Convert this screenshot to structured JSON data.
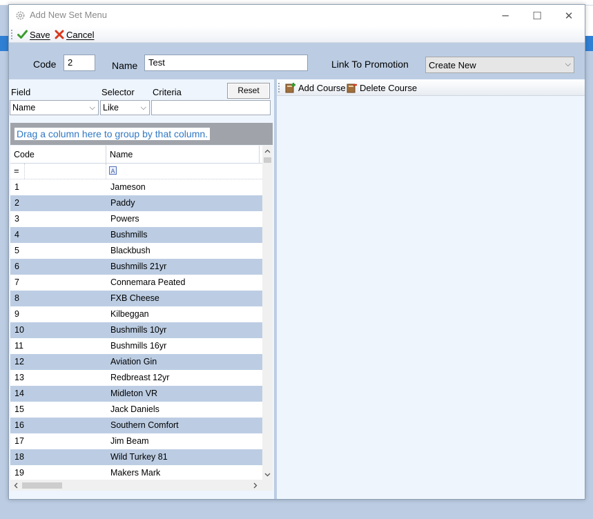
{
  "window": {
    "title": "Add New Set Menu",
    "min_glyph": "─",
    "max_glyph": "☐",
    "close_glyph": "✕"
  },
  "toolbar": {
    "save_label": "Save",
    "cancel_label": "Cancel"
  },
  "form": {
    "code_label": "Code",
    "code_value": "2",
    "name_label": "Name",
    "name_value": "Test",
    "promotion_label": "Link To Promotion",
    "promotion_value": "Create New"
  },
  "filter": {
    "field_label": "Field",
    "selector_label": "Selector",
    "criteria_label": "Criteria",
    "field_value": "Name",
    "selector_value": "Like",
    "criteria_value": "",
    "reset_label": "Reset"
  },
  "grid": {
    "group_hint": "Drag a column here to group by that column.",
    "columns": [
      "Code",
      "Name"
    ],
    "filter_code_symbol": "=",
    "filter_name_symbol": "A",
    "rows": [
      {
        "code": "1",
        "name": "Jameson"
      },
      {
        "code": "2",
        "name": "Paddy"
      },
      {
        "code": "3",
        "name": "Powers"
      },
      {
        "code": "4",
        "name": "Bushmills"
      },
      {
        "code": "5",
        "name": "Blackbush"
      },
      {
        "code": "6",
        "name": "Bushmills 21yr"
      },
      {
        "code": "7",
        "name": "Connemara Peated"
      },
      {
        "code": "8",
        "name": "FXB Cheese"
      },
      {
        "code": "9",
        "name": "Kilbeggan"
      },
      {
        "code": "10",
        "name": "Bushmills 10yr"
      },
      {
        "code": "11",
        "name": "Bushmills 16yr"
      },
      {
        "code": "12",
        "name": "Aviation Gin"
      },
      {
        "code": "13",
        "name": "Redbreast 12yr"
      },
      {
        "code": "14",
        "name": "Midleton VR"
      },
      {
        "code": "15",
        "name": "Jack Daniels"
      },
      {
        "code": "16",
        "name": "Southern Comfort"
      },
      {
        "code": "17",
        "name": "Jim Beam"
      },
      {
        "code": "18",
        "name": "Wild Turkey 81"
      },
      {
        "code": "19",
        "name": "Makers Mark"
      }
    ]
  },
  "courses": {
    "add_label": "Add Course",
    "delete_label": "Delete Course"
  },
  "colors": {
    "window_bg": "#bccde3",
    "alt_row": "#bccde3",
    "group_hint_text": "#2f78c4",
    "save_check": "#3a9c2c",
    "cancel_x": "#d9381e"
  }
}
